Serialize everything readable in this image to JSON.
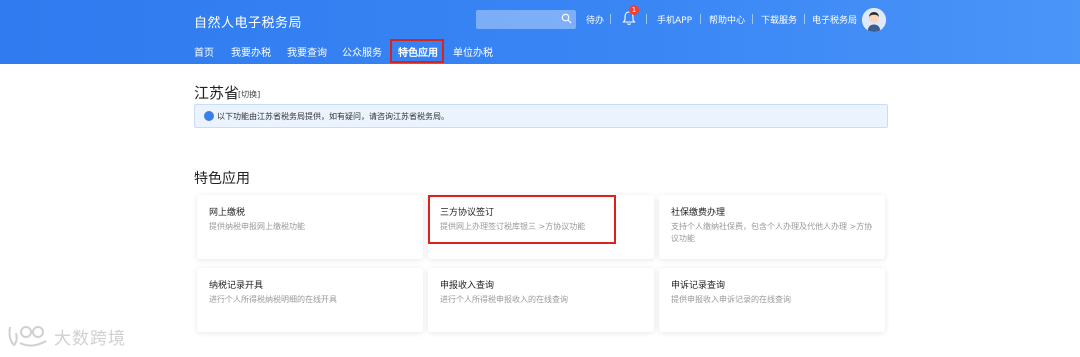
{
  "header": {
    "title": "自然人电子税务局",
    "search": {
      "placeholder": "",
      "icon": "search-icon"
    },
    "todo_label": "待办",
    "notification_count": "1",
    "links": [
      "手机APP",
      "帮助中心",
      "下载服务",
      "电子税务局"
    ],
    "nav": [
      {
        "label": "首页"
      },
      {
        "label": "我要办税"
      },
      {
        "label": "我要查询"
      },
      {
        "label": "公众服务"
      },
      {
        "label": "特色应用",
        "active": true
      },
      {
        "label": "单位办税"
      }
    ]
  },
  "region": {
    "province": "江苏省",
    "switch_label": "[切换]",
    "notice": "以下功能由江苏省税务局提供，如有疑问，请咨询江苏省税务局。"
  },
  "section": {
    "title": "特色应用",
    "cards": [
      {
        "title": "网上缴税",
        "desc": "提供纳税申报网上缴税功能"
      },
      {
        "title": "三方协议签订",
        "desc": "提供网上办理签订税库银三 >方协议功能",
        "highlighted": true
      },
      {
        "title": "社保缴费办理",
        "desc": "支持个人缴纳社保费，包含个人办理及代他人办理 >方协议功能"
      },
      {
        "title": "纳税记录开具",
        "desc": "进行个人所得税纳税明细的在线开具"
      },
      {
        "title": "申报收入查询",
        "desc": "进行个人所得税申报收入的在线查询"
      },
      {
        "title": "申诉记录查询",
        "desc": "提供申报收入申诉记录的在线查询"
      }
    ]
  },
  "watermark": {
    "text": "大数跨境"
  },
  "colors": {
    "header_blue": "#2f7bef",
    "highlight_red": "#d9221c",
    "notice_bg": "#eaf3fe"
  }
}
